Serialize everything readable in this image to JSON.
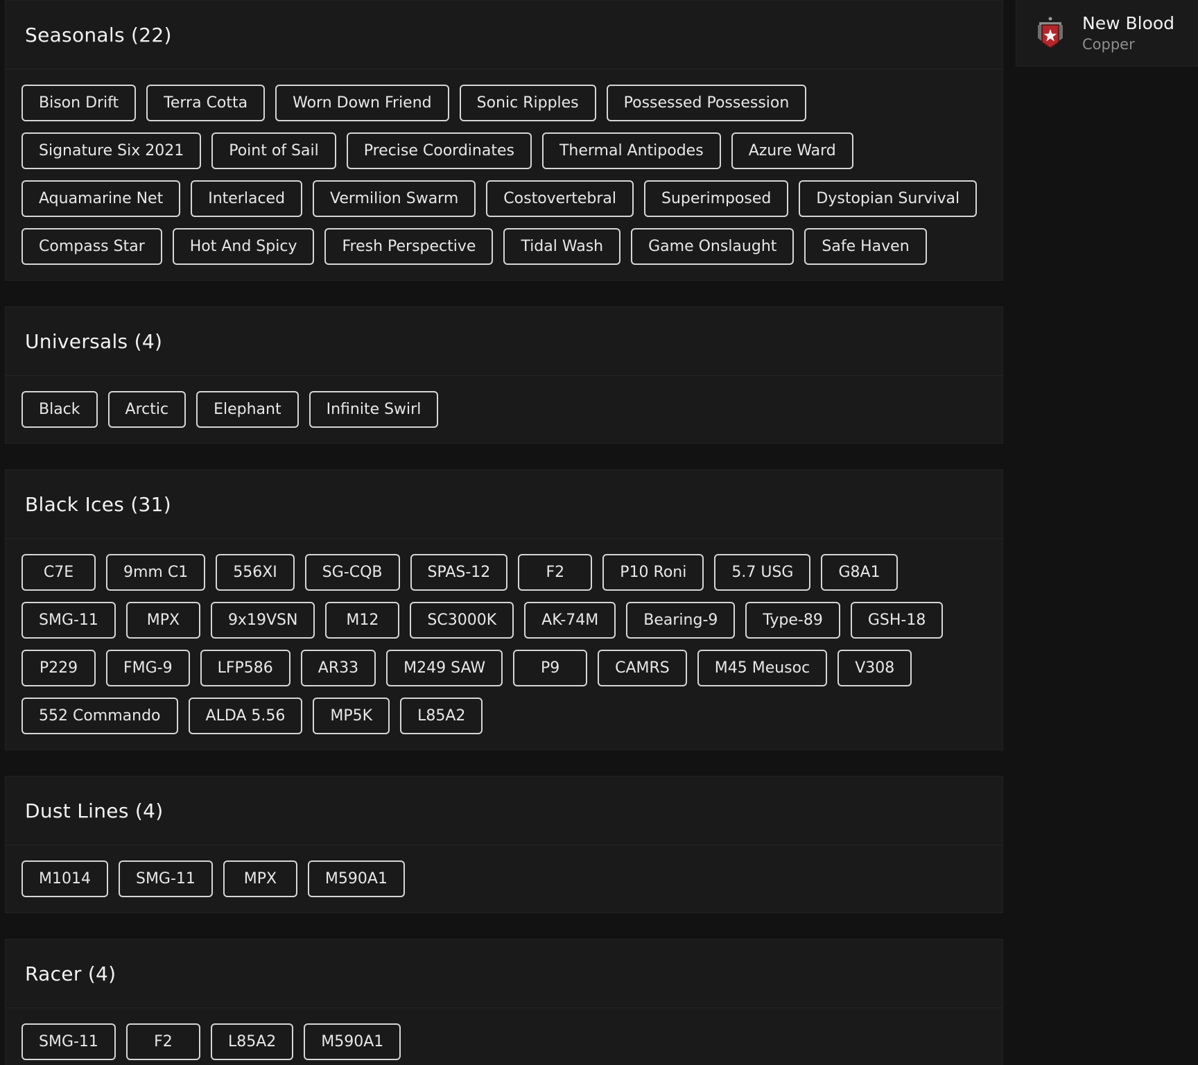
{
  "profile": {
    "name": "New Blood",
    "rank": "Copper",
    "rank_icon": "rank-badge-icon",
    "badge_color": "#b3262b"
  },
  "sections": [
    {
      "title": "Seasonals (22)",
      "items": [
        "Bison Drift",
        "Terra Cotta",
        "Worn Down Friend",
        "Sonic Ripples",
        "Possessed Possession",
        "Signature Six 2021",
        "Point of Sail",
        "Precise Coordinates",
        "Thermal Antipodes",
        "Azure Ward",
        "Aquamarine Net",
        "Interlaced",
        "Vermilion Swarm",
        "Costovertebral",
        "Superimposed",
        "Dystopian Survival",
        "Compass Star",
        "Hot And Spicy",
        "Fresh Perspective",
        "Tidal Wash",
        "Game Onslaught",
        "Safe Haven"
      ]
    },
    {
      "title": "Universals (4)",
      "items": [
        "Black",
        "Arctic",
        "Elephant",
        "Infinite Swirl"
      ]
    },
    {
      "title": "Black Ices (31)",
      "items": [
        "C7E",
        "9mm C1",
        "556XI",
        "SG-CQB",
        "SPAS-12",
        "F2",
        "P10 Roni",
        "5.7 USG",
        "G8A1",
        "SMG-11",
        "MPX",
        "9x19VSN",
        "M12",
        "SC3000K",
        "AK-74M",
        "Bearing-9",
        "Type-89",
        "GSH-18",
        "P229",
        "FMG-9",
        "LFP586",
        "AR33",
        "M249 SAW",
        "P9",
        "CAMRS",
        "M45 Meusoc",
        "V308",
        "552 Commando",
        "ALDA 5.56",
        "MP5K",
        "L85A2"
      ]
    },
    {
      "title": "Dust Lines (4)",
      "items": [
        "M1014",
        "SMG-11",
        "MPX",
        "M590A1"
      ]
    },
    {
      "title": "Racer (4)",
      "items": [
        "SMG-11",
        "F2",
        "L85A2",
        "M590A1"
      ]
    }
  ]
}
